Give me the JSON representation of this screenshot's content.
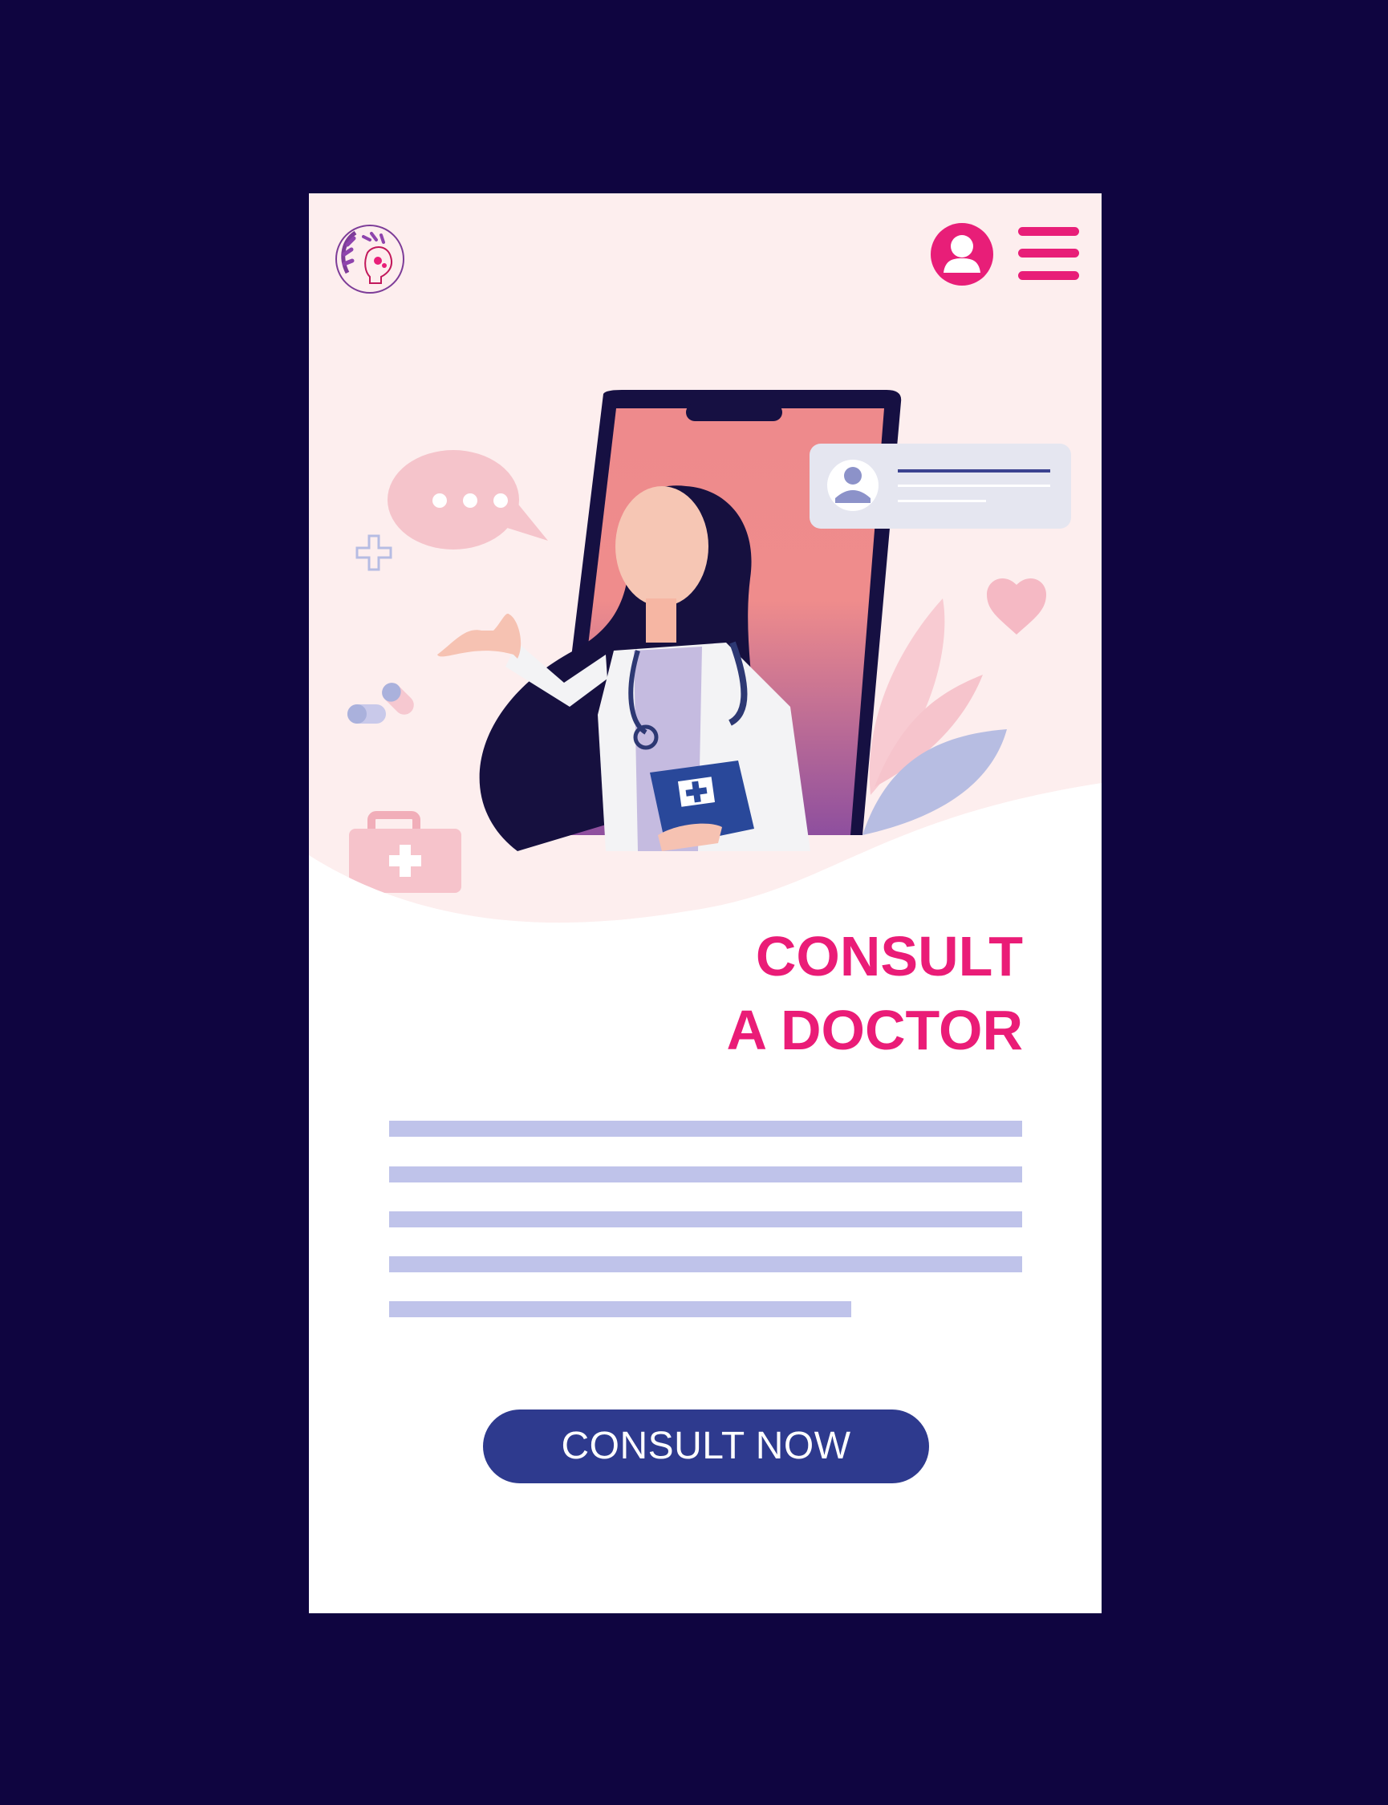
{
  "hero": {
    "headline_line1": "CONSULT",
    "headline_line2": "A DOCTOR"
  },
  "cta": {
    "label": "CONSULT NOW"
  },
  "colors": {
    "page_background": "#0f0540",
    "hero_background": "#fdeeee",
    "accent_pink": "#ea1c77",
    "cta_background": "#2e3a8e",
    "placeholder_text": "#bfc3ea"
  },
  "icons": {
    "logo": "brain-logo-icon",
    "profile": "user-profile-icon",
    "menu": "hamburger-menu-icon"
  }
}
